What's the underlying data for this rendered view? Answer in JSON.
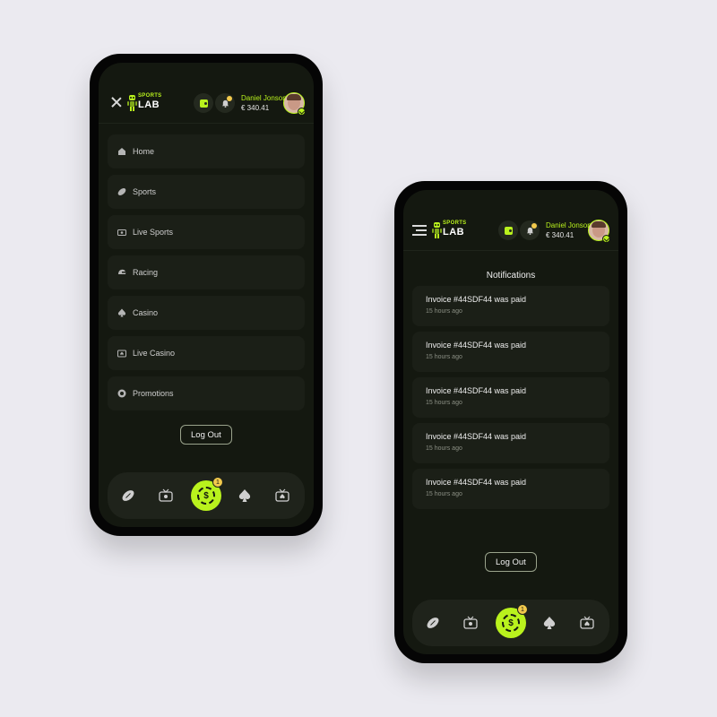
{
  "colors": {
    "accent": "#b9f21d",
    "screen_bg": "#141810",
    "card_bg": "#1b1f17",
    "badge": "#f2c94c"
  },
  "brand": {
    "top": "SPORTS",
    "bottom": "LAB",
    "icon": "robot-mascot"
  },
  "user": {
    "name": "Daniel Jonson",
    "balance": "€ 340.41"
  },
  "menu": {
    "items": [
      {
        "label": "Home",
        "icon": "home-icon"
      },
      {
        "label": "Sports",
        "icon": "football-icon"
      },
      {
        "label": "Live Sports",
        "icon": "tv-icon"
      },
      {
        "label": "Racing",
        "icon": "helmet-icon"
      },
      {
        "label": "Casino",
        "icon": "spade-icon"
      },
      {
        "label": "Live Casino",
        "icon": "live-casino-icon"
      },
      {
        "label": "Promotions",
        "icon": "badge-icon"
      }
    ],
    "logout_label": "Log Out"
  },
  "tabbar": {
    "center_symbol": "$",
    "center_badge": "1",
    "icons": [
      "football-icon",
      "tv-icon",
      "casino-chip-icon",
      "spade-icon",
      "live-casino-icon"
    ]
  },
  "notifications": {
    "title": "Notifications",
    "items": [
      {
        "text": "Invoice #44SDF44 was paid",
        "time": "15 hours ago"
      },
      {
        "text": "Invoice #44SDF44 was paid",
        "time": "15 hours ago"
      },
      {
        "text": "Invoice #44SDF44 was paid",
        "time": "15 hours ago"
      },
      {
        "text": "Invoice #44SDF44 was paid",
        "time": "15 hours ago"
      },
      {
        "text": "Invoice #44SDF44 was paid",
        "time": "15 hours ago"
      }
    ],
    "logout_label": "Log Out"
  }
}
